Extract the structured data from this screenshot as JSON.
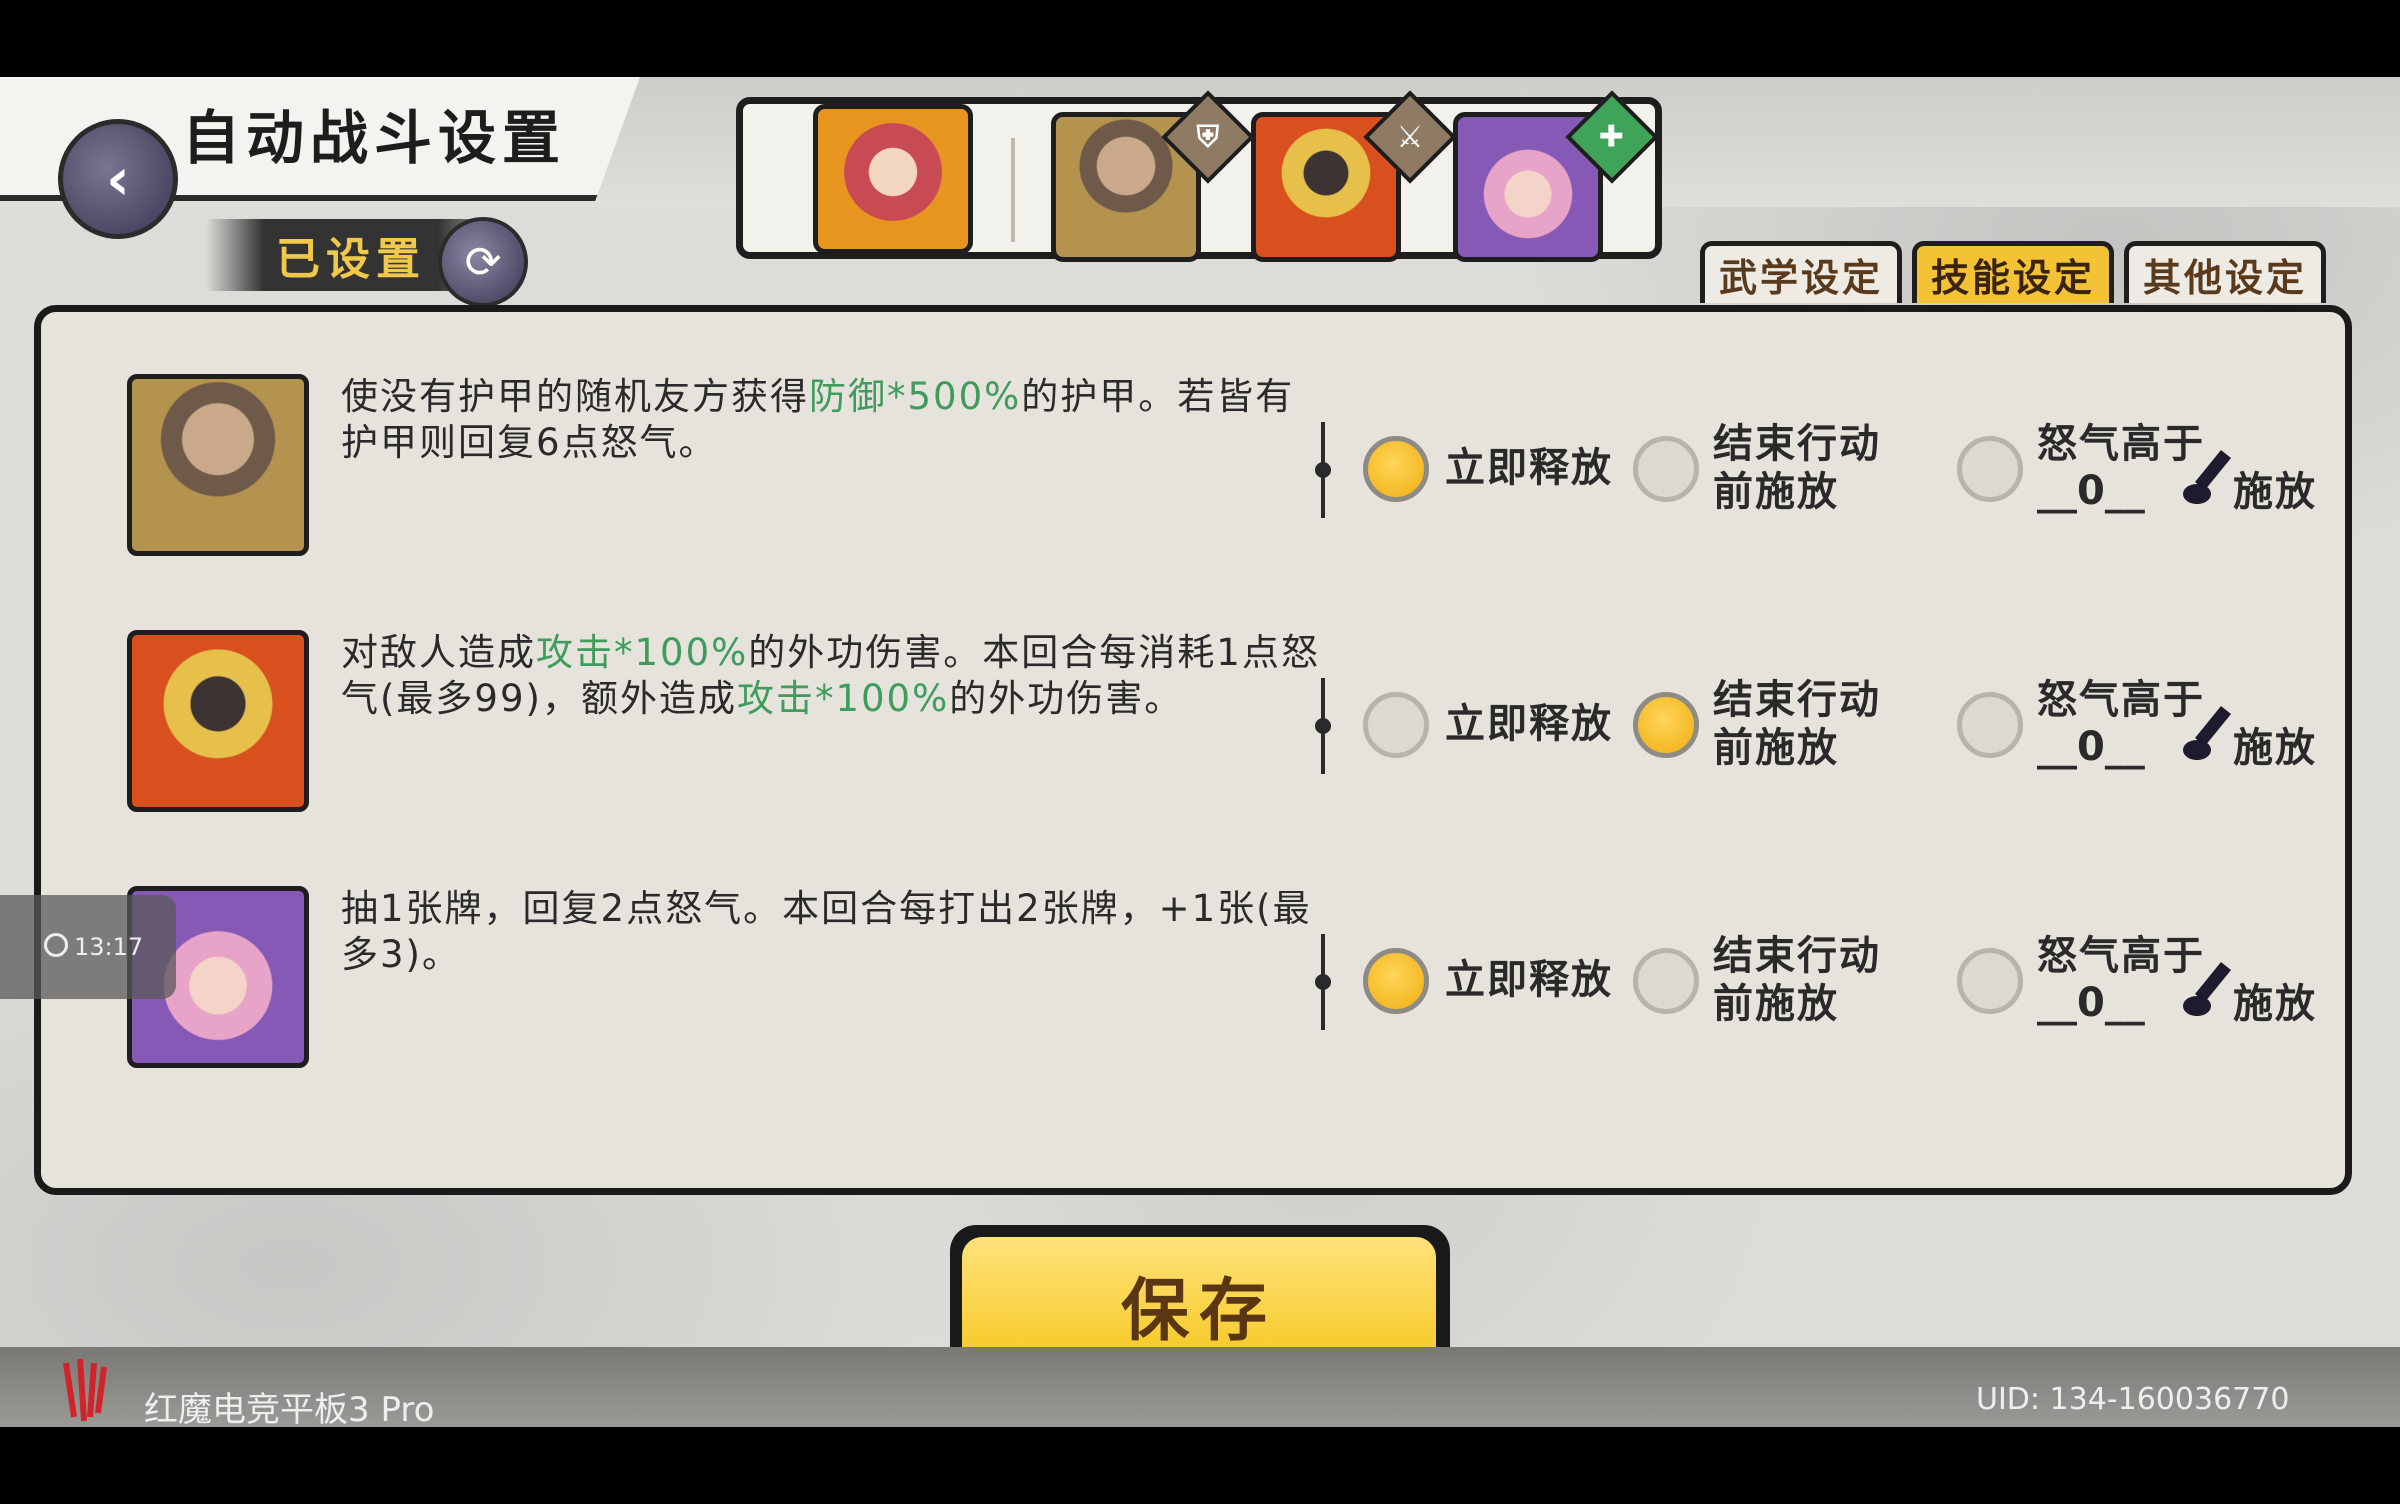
{
  "header": {
    "title": "自动战斗设置",
    "status_label": "已设置",
    "back_icon": "back-arrow-icon"
  },
  "tabs": [
    {
      "label": "武学设定",
      "active": false
    },
    {
      "label": "技能设定",
      "active": true
    },
    {
      "label": "其他设定",
      "active": false
    }
  ],
  "options": {
    "immediate": "立即释放",
    "end_action_line1": "结束行动",
    "end_action_line2": "前施放",
    "rage_line1": "怒气高于",
    "rage_suffix": "施放"
  },
  "skills": [
    {
      "desc_pre": "使没有护甲的随机友方获得",
      "desc_hl1": "防御*500%",
      "desc_post": "的护甲。若皆有护甲则回复6点怒气。",
      "selected": "immediate",
      "rage_threshold": "__0__"
    },
    {
      "desc_pre": "对敌人造成",
      "desc_hl1": "攻击*100%",
      "desc_mid": "的外功伤害。本回合每消耗1点怒气(最多99)，额外造成",
      "desc_hl2": "攻击*100%",
      "desc_post": "的外功伤害。",
      "selected": "end_action",
      "rage_threshold": "__0__"
    },
    {
      "desc_pre": "抽1张牌，回复2点怒气。本回合每打出2张牌，+1张(最多3)。",
      "selected": "immediate",
      "rage_threshold": "__0__"
    }
  ],
  "overlay": {
    "time": "13:17"
  },
  "save_label": "保存",
  "footer": {
    "brand": "红魔电竞平板3 Pro",
    "uid": "UID:  134-160036770"
  },
  "colors": {
    "highlight": "#3f9c5c",
    "accent": "#f4c235",
    "selected_radio": "#f0ad10"
  }
}
